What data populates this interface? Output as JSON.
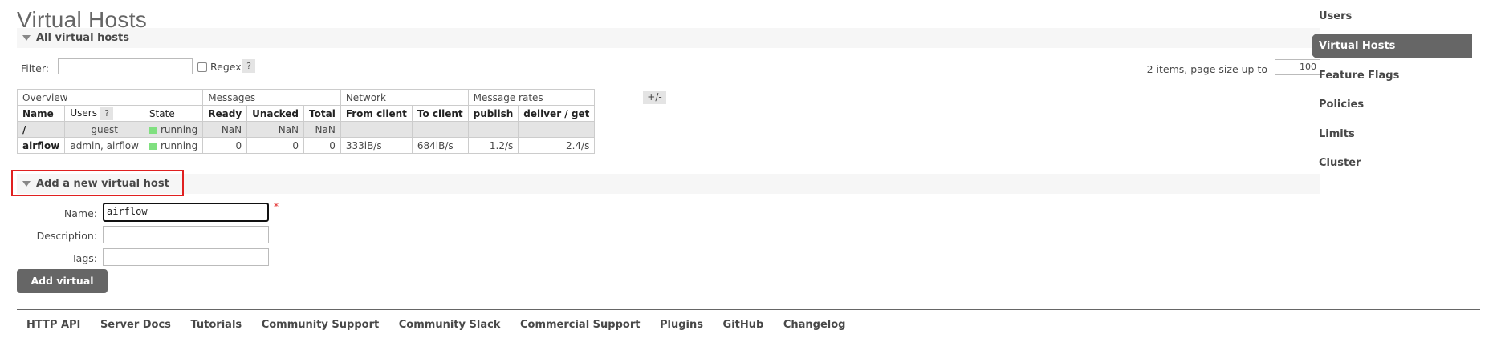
{
  "page": {
    "title": "Virtual Hosts"
  },
  "all_vhosts": {
    "section_title": "All virtual hosts",
    "filter_label": "Filter:",
    "filter_value": "",
    "regex_label": "Regex",
    "help_label": "?",
    "page_size_text": "2 items, page size up to",
    "page_size_value": "100",
    "plus_minus": "+/-",
    "groups": [
      "Overview",
      "Messages",
      "Network",
      "Message rates"
    ],
    "columns": [
      "Name",
      "Users",
      "State",
      "Ready",
      "Unacked",
      "Total",
      "From client",
      "To client",
      "publish",
      "deliver / get"
    ],
    "rows": [
      {
        "name": "/",
        "users": "guest",
        "state": "running",
        "ready": "NaN",
        "unacked": "NaN",
        "total": "NaN",
        "from_client": "",
        "to_client": "",
        "publish": "",
        "deliver_get": ""
      },
      {
        "name": "airflow",
        "users": "admin, airflow",
        "state": "running",
        "ready": "0",
        "unacked": "0",
        "total": "0",
        "from_client": "333iB/s",
        "to_client": "684iB/s",
        "publish": "1.2/s",
        "deliver_get": "2.4/s"
      }
    ]
  },
  "add_vhost": {
    "section_title": "Add a new virtual host",
    "name_label": "Name:",
    "name_value": "airflow",
    "required_mark": "*",
    "description_label": "Description:",
    "description_value": "",
    "tags_label": "Tags:",
    "tags_value": "",
    "submit_label": "Add virtual host"
  },
  "sidebar": {
    "items": [
      {
        "label": "Users",
        "active": false
      },
      {
        "label": "Virtual Hosts",
        "active": true
      },
      {
        "label": "Feature Flags",
        "active": false
      },
      {
        "label": "Policies",
        "active": false
      },
      {
        "label": "Limits",
        "active": false
      },
      {
        "label": "Cluster",
        "active": false
      }
    ]
  },
  "footer": {
    "links": [
      "HTTP API",
      "Server Docs",
      "Tutorials",
      "Community Support",
      "Community Slack",
      "Commercial Support",
      "Plugins",
      "GitHub",
      "Changelog"
    ]
  },
  "colors": {
    "active_nav": "#666666",
    "highlight_border": "#e02020",
    "state_running": "#80e080"
  }
}
